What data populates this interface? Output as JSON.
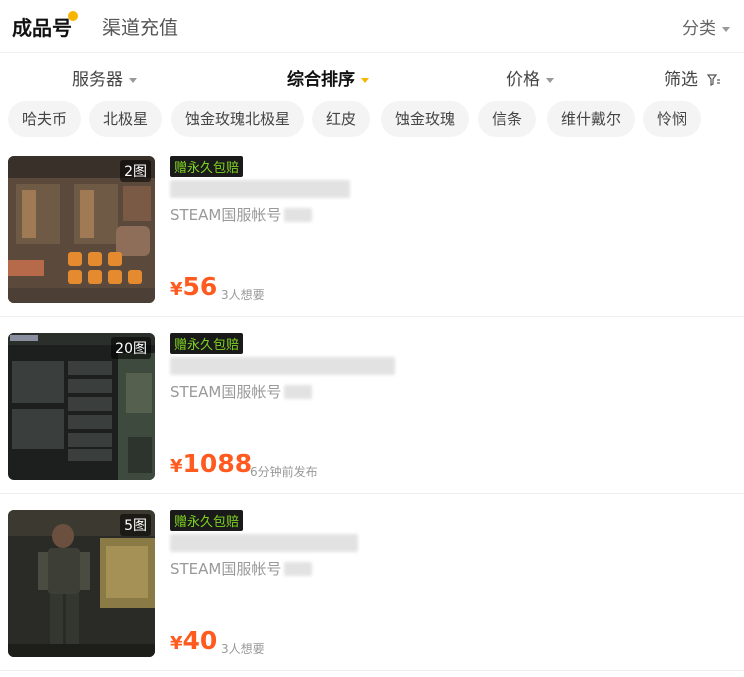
{
  "top_tabs": {
    "active": "成品号",
    "inactive": "渠道充值",
    "category": "分类"
  },
  "sort_bar": {
    "server": "服务器",
    "composite": "综合排序",
    "price": "价格",
    "filter": "筛选"
  },
  "chips": [
    "哈夫币",
    "北极星",
    "蚀金玫瑰北极星",
    "红皮",
    "蚀金玫瑰",
    "信条",
    "维什戴尔",
    "怜悯"
  ],
  "listings": [
    {
      "image_count": "2图",
      "badge": "赠永久包赔",
      "platform": "STEAM国服帐号",
      "price_symbol": "¥",
      "price": "56",
      "meta": "3人想要"
    },
    {
      "image_count": "20图",
      "badge": "赠永久包赔",
      "platform": "STEAM国服帐号",
      "price_symbol": "¥",
      "price": "1088",
      "meta": "6分钟前发布"
    },
    {
      "image_count": "5图",
      "badge": "赠永久包赔",
      "platform": "STEAM国服帐号",
      "price_symbol": "¥",
      "price": "40",
      "meta": "3人想要"
    }
  ]
}
